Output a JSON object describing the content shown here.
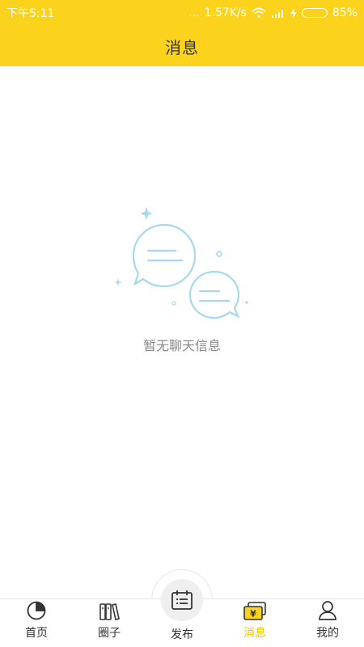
{
  "status_bar": {
    "time": "下午5:11",
    "dots": "...",
    "network_speed": "1.57K/s",
    "battery_percent": "85%",
    "battery_level": 0.85
  },
  "header": {
    "title": "消息"
  },
  "empty_state": {
    "message": "暂无聊天信息"
  },
  "nav": {
    "items": [
      {
        "label": "首页",
        "icon": "pie-chart-icon"
      },
      {
        "label": "圈子",
        "icon": "books-icon"
      },
      {
        "label": "发布",
        "icon": "calendar-list-icon"
      },
      {
        "label": "消息",
        "icon": "yen-cards-icon",
        "active": true
      },
      {
        "label": "我的",
        "icon": "user-icon"
      }
    ]
  },
  "colors": {
    "brand_yellow": "#fcd31c",
    "active_text": "#f5c400",
    "illustration_blue": "#a6d8f2"
  }
}
